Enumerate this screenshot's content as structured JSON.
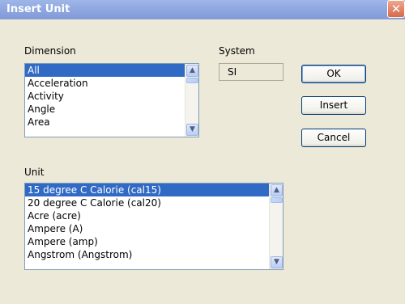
{
  "window": {
    "title": "Insert Unit",
    "close_symbol": "✕"
  },
  "dimension": {
    "label": "Dimension",
    "items": [
      "All",
      "Acceleration",
      "Activity",
      "Angle",
      "Area"
    ],
    "selected_index": 0
  },
  "system": {
    "label": "System",
    "value": "SI"
  },
  "buttons": {
    "ok": "OK",
    "insert": "Insert",
    "cancel": "Cancel"
  },
  "unit": {
    "label": "Unit",
    "items": [
      "15 degree C Calorie (cal15)",
      "20 degree C Calorie (cal20)",
      "Acre (acre)",
      "Ampere (A)",
      "Ampere (amp)",
      "Angstrom (Angstrom)"
    ],
    "selected_index": 0
  },
  "icons": {
    "scroll_up": "up-arrow-icon",
    "scroll_down": "down-arrow-icon",
    "close": "close-icon"
  }
}
